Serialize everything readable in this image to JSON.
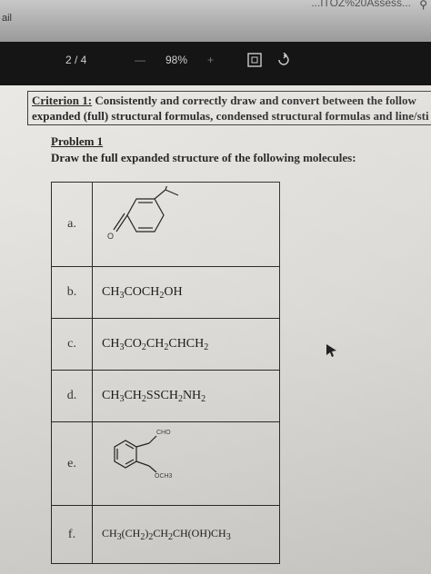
{
  "browser": {
    "url_fragment": "...ITOZ%20Assess...",
    "tab_label": "ail",
    "search_icon": "search-icon"
  },
  "viewer": {
    "page_indicator": "2 / 4",
    "minus": "—",
    "zoom": "98%",
    "plus": "+"
  },
  "criterion": {
    "label": "Criterion 1:",
    "line1_rest": " Consistently and correctly draw and convert between the follow",
    "line2": "expanded (full) structural formulas, condensed structural formulas and line/sti"
  },
  "problem": {
    "title": "Problem 1",
    "instruction": "Draw the full expanded structure of the following molecules:"
  },
  "rows": [
    {
      "label": "a.",
      "content": ""
    },
    {
      "label": "b.",
      "content": "CH3COCH2OH"
    },
    {
      "label": "c.",
      "content": "CH3CO2CH2CHCH2"
    },
    {
      "label": "d.",
      "content": "CH3CH2SSCH2NH2"
    },
    {
      "label": "e.",
      "content": ""
    },
    {
      "label": "f.",
      "content": "CH3(CH2)2CH2CH(OH)CH3"
    }
  ],
  "structure_e": {
    "top": "CHO",
    "bottom": "OCH3"
  },
  "structure_a": {
    "atom": "O"
  }
}
